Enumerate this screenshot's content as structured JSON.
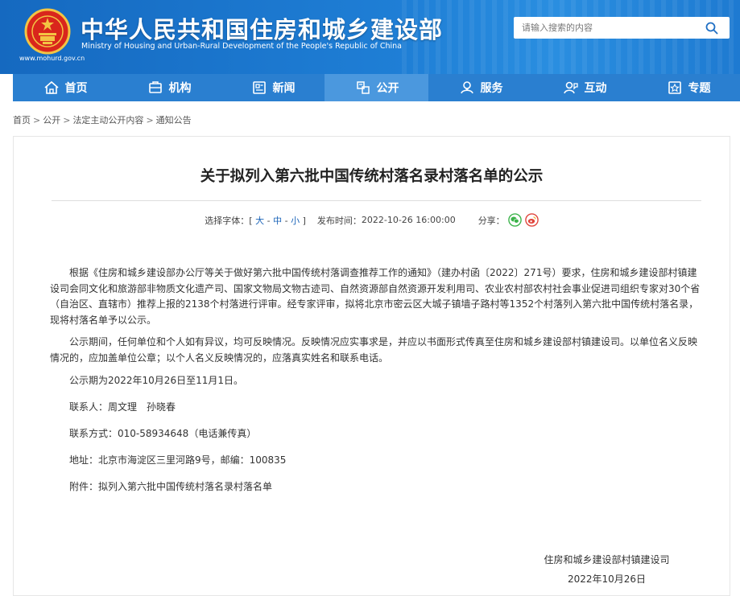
{
  "header": {
    "title": "中华人民共和国住房和城乡建设部",
    "subtitle": "Ministry of Housing and Urban-Rural Development of the People's Republic of China",
    "url": "www.mohurd.gov.cn",
    "emblem_icon": "national-emblem-icon",
    "colors": {
      "primary": "#1f7fd6",
      "nav": "#2a7fd0",
      "nav_active": "#4b98de"
    }
  },
  "search": {
    "placeholder": "请输入搜索的内容",
    "button_icon": "search-icon"
  },
  "nav": {
    "items": [
      {
        "label": "首页",
        "icon": "home-icon"
      },
      {
        "label": "机构",
        "icon": "organization-icon"
      },
      {
        "label": "新闻",
        "icon": "news-icon"
      },
      {
        "label": "公开",
        "icon": "disclosure-icon",
        "active": true
      },
      {
        "label": "服务",
        "icon": "service-icon"
      },
      {
        "label": "互动",
        "icon": "interaction-icon"
      },
      {
        "label": "专题",
        "icon": "topics-icon"
      }
    ]
  },
  "breadcrumb": {
    "items": [
      "首页",
      "公开",
      "法定主动公开内容",
      "通知公告"
    ],
    "separator": ">"
  },
  "article": {
    "title": "关于拟列入第六批中国传统村落名录村落名单的公示",
    "font_label": "选择字体：",
    "font_open": "[",
    "font_large": "大",
    "font_medium": "中",
    "font_small": "小",
    "font_close": "]",
    "font_dash": "-",
    "publish_label": "发布时间：",
    "publish_time": "2022-10-26 16:00:00",
    "share_label": "分享：",
    "share_icons": [
      "wechat-icon",
      "weibo-icon"
    ],
    "paragraphs": [
      "根据《住房和城乡建设部办公厅等关于做好第六批中国传统村落调查推荐工作的通知》（建办村函〔2022〕271号）要求，住房和城乡建设部村镇建设司会同文化和旅游部非物质文化遗产司、国家文物局文物古迹司、自然资源部自然资源开发利用司、农业农村部农村社会事业促进司组织专家对30个省（自治区、直辖市）推荐上报的2138个村落进行评审。经专家评审，拟将北京市密云区大城子镇墙子路村等1352个村落列入第六批中国传统村落名录，现将村落名单予以公示。",
      "公示期间，任何单位和个人如有异议，均可反映情况。反映情况应实事求是，并应以书面形式传真至住房和城乡建设部村镇建设司。以单位名义反映情况的，应加盖单位公章；以个人名义反映情况的，应落真实姓名和联系电话。",
      "公示期为2022年10月26日至11月1日。",
      "联系人：周文理　孙晓春",
      "联系方式：010-58934648（电话兼传真）",
      "地址：北京市海淀区三里河路9号，邮编：100835",
      "附件：拟列入第六批中国传统村落名录村落名单"
    ],
    "signature_org": "住房和城乡建设部村镇建设司",
    "signature_date": "2022年10月26日"
  }
}
